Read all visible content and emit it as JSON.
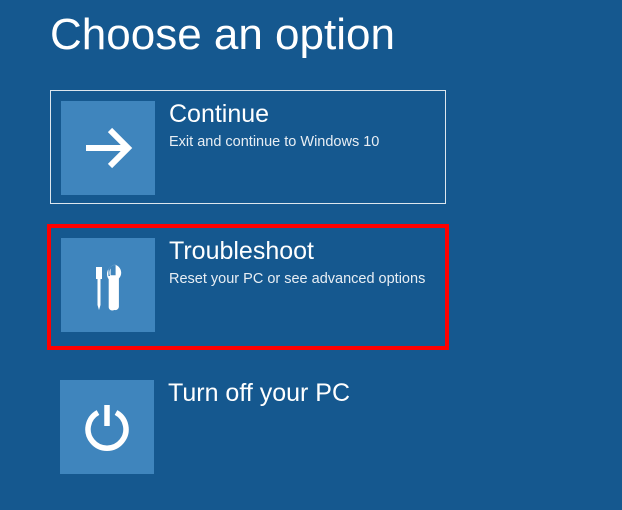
{
  "title": "Choose an option",
  "options": [
    {
      "title": "Continue",
      "desc": "Exit and continue to Windows 10"
    },
    {
      "title": "Troubleshoot",
      "desc": "Reset your PC or see advanced options"
    },
    {
      "title": "Turn off your PC",
      "desc": ""
    }
  ]
}
